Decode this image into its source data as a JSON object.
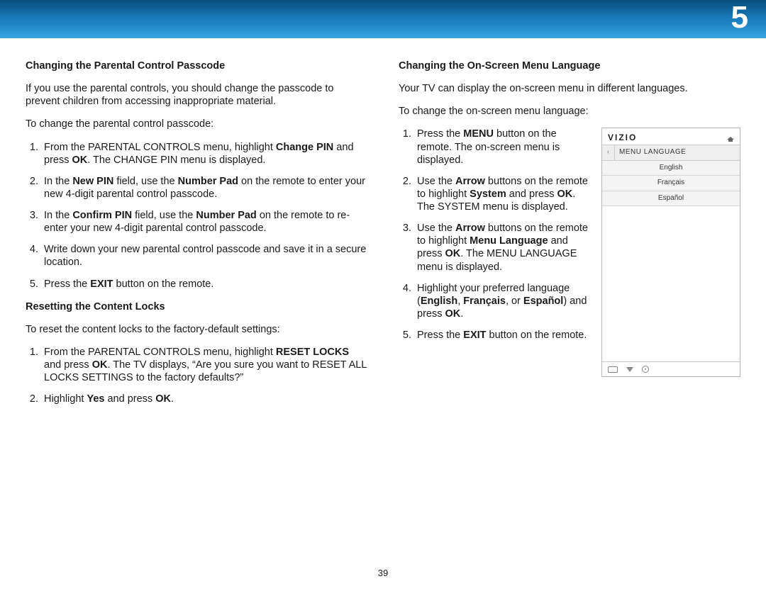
{
  "chapter_number": "5",
  "page_number": "39",
  "left": {
    "h1": "Changing the Parental Control Passcode",
    "p1": "If you use the parental controls, you should change the passcode to prevent children from accessing inappropriate material.",
    "p2": "To change the parental control passcode:",
    "steps1": [
      {
        "pre": "From the PARENTAL CONTROLS menu, highlight ",
        "b1": "Change PIN",
        "post1": " and press ",
        "b2": "OK",
        "post2": ". The CHANGE PIN menu is displayed."
      },
      {
        "pre": "In the ",
        "b1": "New PIN",
        "post1": " field, use the ",
        "b2": "Number Pad",
        "post2": " on the remote to enter your new 4-digit parental control passcode."
      },
      {
        "pre": "In the ",
        "b1": "Confirm PIN",
        "post1": " field, use the ",
        "b2": "Number Pad",
        "post2": " on the remote to re-enter your new 4-digit parental control passcode."
      },
      {
        "pre": "Write down your new parental control passcode and save it in a secure location.",
        "b1": "",
        "post1": "",
        "b2": "",
        "post2": ""
      },
      {
        "pre": "Press the ",
        "b1": "EXIT",
        "post1": " button on the remote.",
        "b2": "",
        "post2": ""
      }
    ],
    "h2": "Resetting the Content Locks",
    "p3": "To reset the content locks to the factory-default settings:",
    "steps2": [
      {
        "pre": "From the PARENTAL CONTROLS menu, highlight ",
        "b1": "RESET LOCKS",
        "post1": " and press ",
        "b2": "OK",
        "post2": ". The TV displays, “Are you sure you want to RESET ALL LOCKS SETTINGS to the factory defaults?”"
      },
      {
        "pre": "Highlight ",
        "b1": "Yes",
        "post1": " and press ",
        "b2": "OK",
        "post2": "."
      }
    ]
  },
  "right": {
    "h1": "Changing the On-Screen Menu Language",
    "p1": "Your TV can display the on-screen menu in different languages.",
    "p2": "To change the on-screen menu language:",
    "steps": [
      {
        "pre": "Press the ",
        "b1": "MENU",
        "post1": " button on the remote. The on-screen menu is displayed.",
        "b2": "",
        "post2": "",
        "b3": "",
        "post3": ""
      },
      {
        "pre": "Use the ",
        "b1": "Arrow",
        "post1": " buttons on the remote to highlight ",
        "b2": "System",
        "post2": " and press ",
        "b3": "OK",
        "post3": ". The SYSTEM menu is displayed."
      },
      {
        "pre": "Use the ",
        "b1": "Arrow",
        "post1": " buttons on the remote to highlight ",
        "b2": "Menu Language",
        "post2": " and press ",
        "b3": "OK",
        "post3": ". The MENU LANGUAGE menu is displayed."
      },
      {
        "pre": "Highlight your preferred language (",
        "b1": "English",
        "post1": ", ",
        "b2": "Français",
        "post2": ", or ",
        "b3": "Español",
        "post3": ") and press ",
        "b4": "OK",
        "post4": "."
      },
      {
        "pre": "Press the ",
        "b1": "EXIT",
        "post1": " button on the remote.",
        "b2": "",
        "post2": "",
        "b3": "",
        "post3": ""
      }
    ]
  },
  "tv": {
    "brand": "VIZIO",
    "crumb": "MENU LANGUAGE",
    "back": "‹",
    "langs": [
      "English",
      "Français",
      "Español"
    ]
  }
}
